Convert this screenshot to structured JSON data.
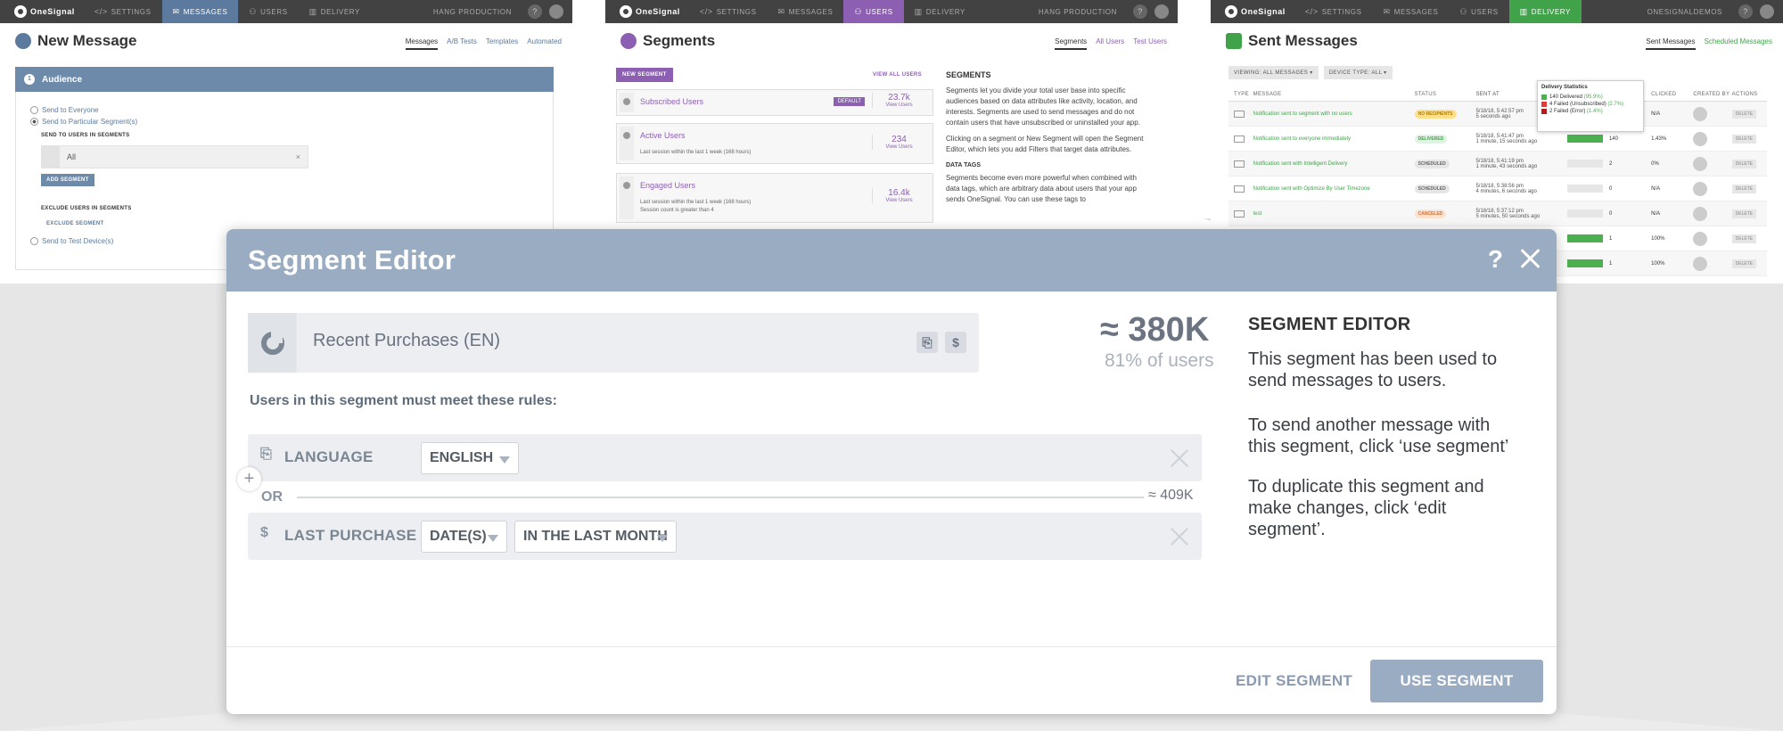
{
  "colors": {
    "messages_accent": "#5c7a9e",
    "users_accent": "#8c5fb2",
    "delivery_accent": "#40a34a",
    "modal_header": "#9aacc1",
    "topbar": "#424242"
  },
  "topbar": {
    "logo": "OneSignal",
    "nav": [
      "SETTINGS",
      "MESSAGES",
      "USERS",
      "DELIVERY"
    ],
    "help": "?"
  },
  "panel_messages": {
    "org": "HANG PRODUCTION",
    "title": "New Message",
    "tabs": [
      "Messages",
      "A/B Tests",
      "Templates",
      "Automated"
    ],
    "section": "Audience",
    "section_num": "1",
    "opt_everyone": "Send to Everyone",
    "opt_particular": "Send to Particular Segment(s)",
    "send_label": "SEND TO USERS IN SEGMENTS",
    "segment_value": "All",
    "remove": "×",
    "add_segment": "ADD SEGMENT",
    "exclude_label": "EXCLUDE USERS IN SEGMENTS",
    "exclude_link": "EXCLUDE SEGMENT",
    "opt_test": "Send to Test Device(s)"
  },
  "panel_segments": {
    "org": "HANG PRODUCTION",
    "title": "Segments",
    "tabs": [
      "Segments",
      "All Users",
      "Test Users"
    ],
    "new_segment": "NEW SEGMENT",
    "view_all": "VIEW ALL USERS",
    "view_users": "View Users",
    "segments": [
      {
        "name": "Subscribed Users",
        "count": "23.7k",
        "badge": "DEFAULT",
        "rules": []
      },
      {
        "name": "Active Users",
        "count": "234",
        "badge": "",
        "rules": [
          "Last session within the last 1 week (168 hours)"
        ]
      },
      {
        "name": "Engaged Users",
        "count": "16.4k",
        "badge": "",
        "rules": [
          "Last session within the last 1 week (168 hours)",
          "Session count is greater than 4"
        ]
      }
    ],
    "side_title": "SEGMENTS",
    "side_p1": "Segments let you divide your total user base into specific audiences based on data attributes like activity, location, and interests. Segments are used to send messages and do not contain users that have unsubscribed or uninstalled your app.",
    "side_p2": "Clicking on a segment or New Segment will open the Segment Editor, which lets you add Filters that target data attributes.",
    "side_h2": "DATA TAGS",
    "side_p3": "Segments become even more powerful when combined with data tags, which are arbitrary data about users that your app sends OneSignal. You can use these tags to"
  },
  "panel_delivery": {
    "org": "ONESIGNALDEMOS",
    "title": "Sent Messages",
    "tabs": [
      "Sent Messages",
      "Scheduled Messages"
    ],
    "filter_viewing": "VIEWING: ALL MESSAGES ▾",
    "filter_device": "DEVICE TYPE: ALL ▾",
    "columns": [
      "TYPE",
      "MESSAGE",
      "STATUS",
      "SENT AT",
      "",
      "",
      "CLICKED",
      "CREATED BY",
      "ACTIONS"
    ],
    "rows": [
      {
        "message": "Notification sent to segment with no users",
        "status": "NO RECIPIENTS",
        "sent": "5/18/18, 5:42:57 pm",
        "ago": "5 seconds ago",
        "sent_n": "",
        "ctr": "N/A",
        "bar": 0
      },
      {
        "message": "Notification sent to everyone immediately",
        "status": "DELIVERED",
        "sent": "5/18/18, 5:41:47 pm",
        "ago": "1 minute, 15 seconds ago",
        "sent_n": "140",
        "ctr": "1.43%",
        "bar": 1
      },
      {
        "message": "Notification sent with Intelligent Delivery",
        "status": "SCHEDULED",
        "sent": "5/18/18, 5:41:19 pm",
        "ago": "1 minute, 43 seconds ago",
        "sent_n": "2",
        "ctr": "0%",
        "bar": 0
      },
      {
        "message": "Notification sent with Optimize By User Timezone",
        "status": "SCHEDULED",
        "sent": "5/18/18, 5:38:56 pm",
        "ago": "4 minutes, 6 seconds ago",
        "sent_n": "0",
        "ctr": "N/A",
        "bar": 0
      },
      {
        "message": "test",
        "status": "CANCELED",
        "sent": "5/18/18, 5:37:12 pm",
        "ago": "5 minutes, 50 seconds ago",
        "sent_n": "0",
        "ctr": "N/A",
        "bar": 0
      },
      {
        "message": "",
        "status": "",
        "sent": "",
        "ago": "",
        "sent_n": "1",
        "ctr": "100%",
        "bar": 1
      },
      {
        "message": "",
        "status": "",
        "sent": "",
        "ago": "",
        "sent_n": "1",
        "ctr": "100%",
        "bar": 1
      }
    ],
    "delete": "DELETE",
    "popup_title": "Delivery Statistics",
    "popup_lines": [
      {
        "text": "140 Delivered",
        "pct": "(95.9%)",
        "color": "#4caf50"
      },
      {
        "text": "4 Failed (Unsubscribed)",
        "pct": "(2.7%)",
        "color": "#e53935"
      },
      {
        "text": "2 Failed (Error)",
        "pct": "(1.4%)",
        "color": "#b71c1c"
      }
    ]
  },
  "modal": {
    "title": "Segment Editor",
    "help": "?",
    "segment_name": "Recent Purchases (EN)",
    "tag_icons": [
      "language-tag",
      "dollar-tag"
    ],
    "count": "≈ 380K",
    "percent": "81% of users",
    "rules_heading": "Users in this segment must meet these rules:",
    "rule1": {
      "label": "LANGUAGE",
      "value": "ENGLISH"
    },
    "or_label": "OR",
    "or_count": "≈ 409K",
    "rule2": {
      "label": "LAST PURCHASE",
      "value1": "DATE(S)",
      "value2": "IN THE LAST MONTH"
    },
    "help_title": "SEGMENT EDITOR",
    "help_p1": "This segment has been used to send messages to users.",
    "help_p2": "To send another message with this segment, click ‘use segment’",
    "help_p3": "To duplicate this segment and make changes, click ‘edit segment’.",
    "edit_button": "EDIT SEGMENT",
    "use_button": "USE SEGMENT"
  }
}
